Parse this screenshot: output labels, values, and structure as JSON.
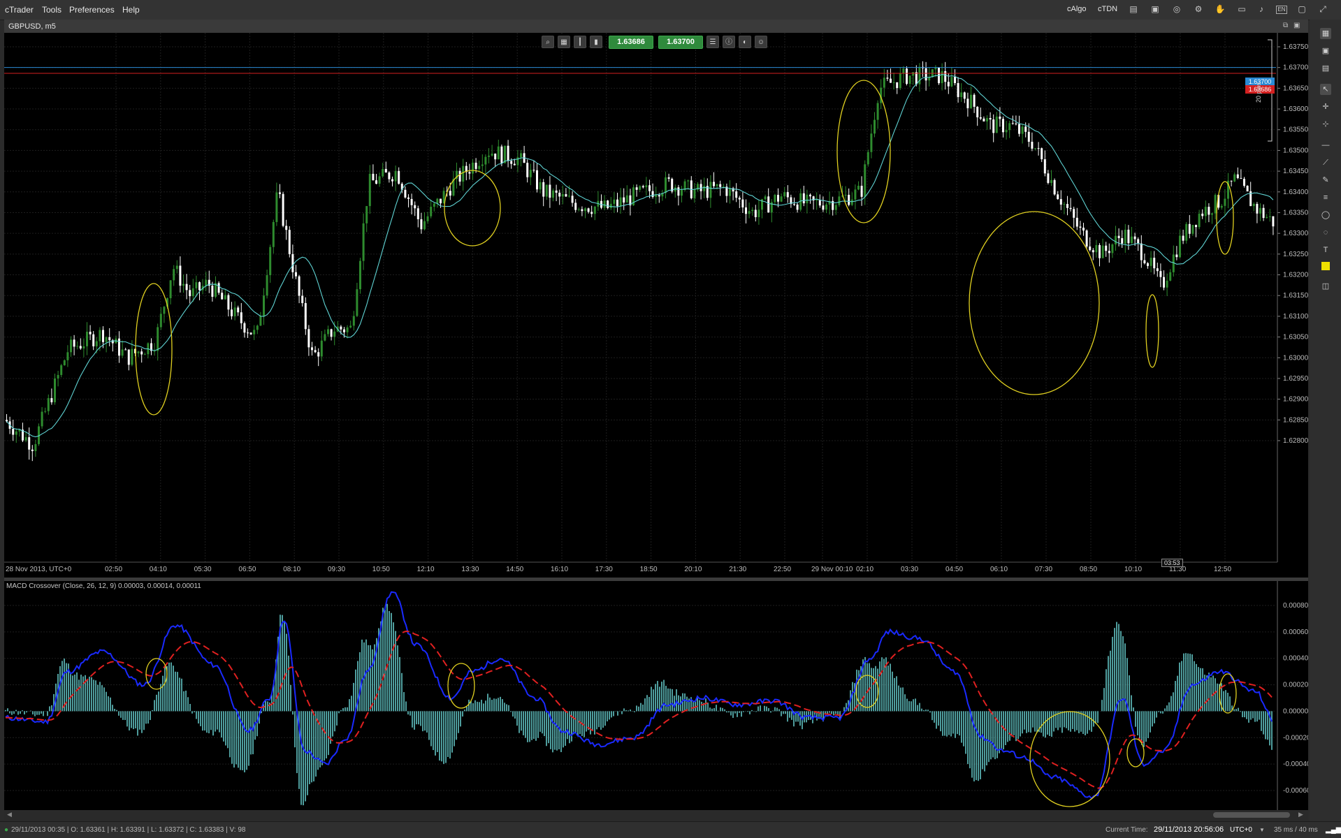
{
  "menu": {
    "items": [
      "cTrader",
      "Tools",
      "Preferences",
      "Help"
    ]
  },
  "top_right": {
    "calgo": "cAlgo",
    "ctdn": "cTDN",
    "lang": "EN"
  },
  "chart": {
    "symbol": "GBPUSD, m5",
    "bid_price": "1.63686",
    "ask_price": "1.63700",
    "ask_line_label": "1.63700",
    "bid_line_label": "1.63686",
    "spread_label": "20 pips",
    "cursor_time": "03:53",
    "price_axis": [
      "1.63750",
      "1.63700",
      "1.63650",
      "1.63600",
      "1.63550",
      "1.63500",
      "1.63450",
      "1.63400",
      "1.63350",
      "1.63300",
      "1.63250",
      "1.63200",
      "1.63150",
      "1.63100",
      "1.63050",
      "1.63000",
      "1.62950",
      "1.62900",
      "1.62850",
      "1.62800"
    ],
    "time_axis": [
      "28 Nov 2013, UTC+0",
      "02:50",
      "04:10",
      "05:30",
      "06:50",
      "08:10",
      "09:30",
      "10:50",
      "12:10",
      "13:30",
      "14:50",
      "16:10",
      "17:30",
      "18:50",
      "20:10",
      "21:30",
      "22:50",
      "29 Nov 00:10",
      "02:10",
      "03:30",
      "04:50",
      "06:10",
      "07:30",
      "08:50",
      "10:10",
      "11:30",
      "12:50"
    ],
    "colors": {
      "bull": "#2e8b2e",
      "bear": "#ffffff",
      "ma": "#5fd3d3",
      "ask_line": "#2a8ad4",
      "bid_line": "#d42020",
      "highlight": "#e0d020"
    },
    "icons": [
      "zoom-icon",
      "chart-type-icon",
      "bar-type-icon",
      "candle-type-icon",
      "list-icon",
      "info-icon",
      "sentiment-icon",
      "user-icon"
    ]
  },
  "indicator": {
    "title": "MACD Crossover (Close, 26, 12, 9) 0.00003, 0.00014, 0.00011",
    "axis": [
      "0.00080",
      "0.00060",
      "0.00040",
      "0.00020",
      "0.00000",
      "-0.00020",
      "-0.00040",
      "-0.00060"
    ],
    "colors": {
      "macd": "#1a2aff",
      "signal": "#e02020",
      "hist": "#70e0e0"
    }
  },
  "status": {
    "ohlc": "29/11/2013 00:35 | O: 1.63361 | H: 1.63391 | L: 1.63372 | C: 1.63383 | V: 98",
    "current_time_label": "Current Time:",
    "current_time": "29/11/2013 20:56:06",
    "tz": "UTC+0",
    "latency": "35 ms / 40 ms"
  }
}
